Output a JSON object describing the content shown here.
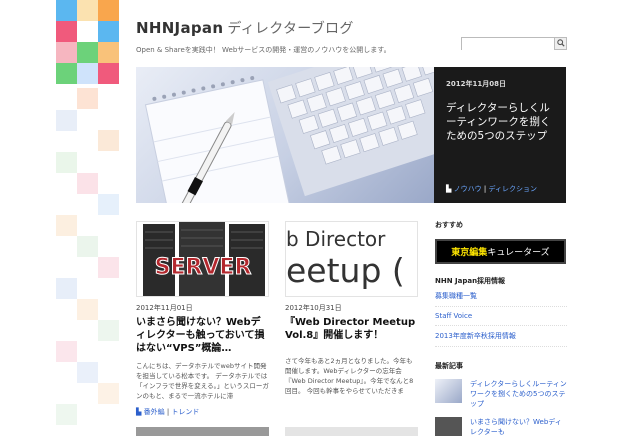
{
  "header": {
    "site_name": "NHNJapan",
    "site_sub": "ディレクターブログ",
    "tagline": "Open & Shareを実践中！ Webサービスの開発・運営のノウハウを公開します。"
  },
  "search": {
    "placeholder": ""
  },
  "hero": {
    "date": "2012年11月08日",
    "title": "ディレクターらしくルーティンワークを捌くための5つのステップ",
    "tag1": "ノウハウ",
    "tag2": "ディレクション"
  },
  "posts": [
    {
      "image_text": "SERVER",
      "date": "2012年11月01日",
      "title": "いまさら聞けない？Webディレクターも触っておいて損はない“VPS”概論…",
      "excerpt": "こんにちは、データホテルでwebサイト開発を担当している松本です。 データホテルでは「インフラで世界を変える。」というスローガンのもと、まるで一流ホテルに滞",
      "tag1": "番外編",
      "tag2": "トレンド"
    },
    {
      "image_line1": "b Director ",
      "image_line2": "eetup (",
      "date": "2012年10月31日",
      "title": "『Web Director Meetup Vol.8』開催します！",
      "excerpt": "さて今年もあと2ヵ月となりました。今年も開催します。Webディレクターの忘年会『Web Director Meetup』。今年でなんと8回目。 今回も幹事をやらせていただきま"
    }
  ],
  "sidebar": {
    "recommend_title": "おすすめ",
    "banner_yellow": "東京編集",
    "banner_white": "キュレーターズ",
    "jobs_title": "NHN Japan採用情報",
    "jobs": [
      "募集職種一覧",
      "Staff Voice",
      "2013年度新卒秋採用情報"
    ],
    "recent_title": "最新記事",
    "recent": [
      "ディレクターらしくルーティンワークを捌くための5つのステップ",
      "いまさら聞けない？Webディレクターも"
    ]
  },
  "colors": {
    "mosaic": [
      "#5bb7f0",
      "#f47a5c",
      "#f9c27a",
      "#6cd27a",
      "#f05a7c"
    ],
    "link": "#2b5fcc",
    "hero_bg": "#1a1a1a"
  }
}
